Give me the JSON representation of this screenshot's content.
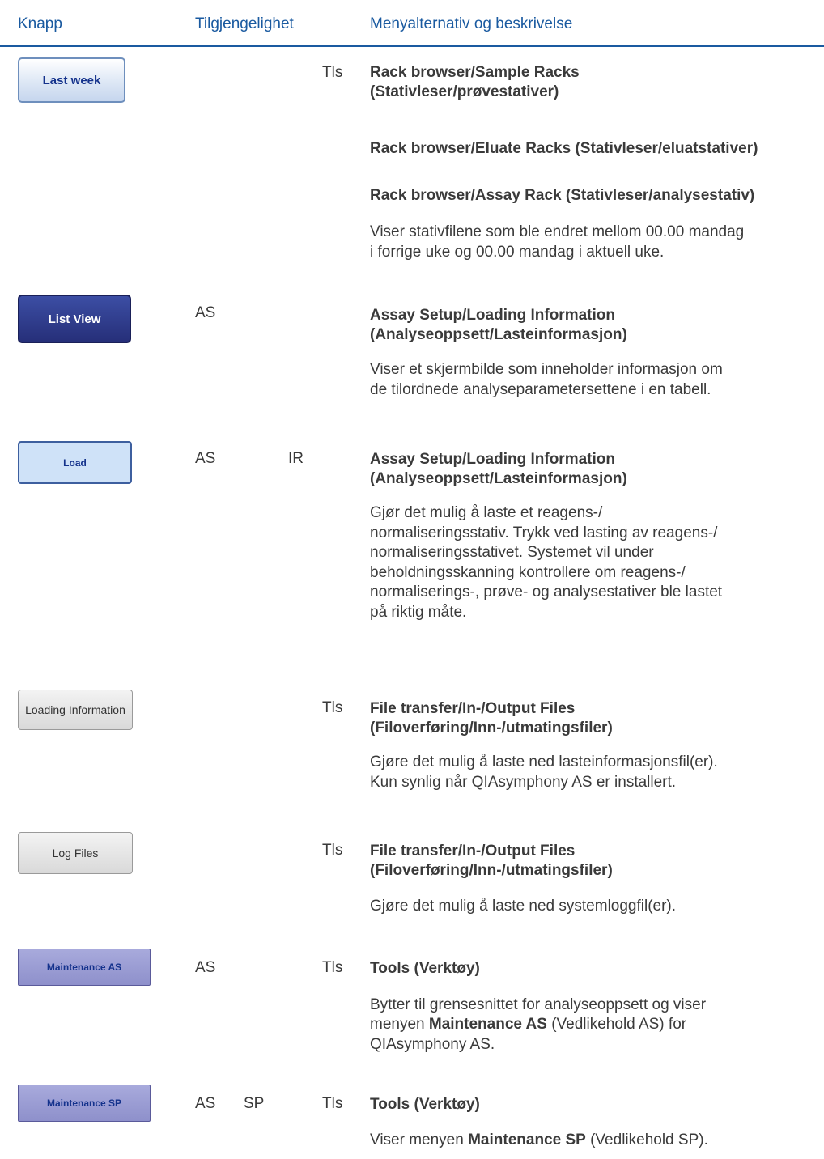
{
  "header": {
    "col_button": "Knapp",
    "col_availability": "Tilgjengelighet",
    "col_menu": "Menyalternativ og beskrivelse"
  },
  "rows": [
    {
      "button": "Last week",
      "tls": "Tls",
      "menus": [
        "Rack browser/Sample Racks",
        "(Stativleser/prøvestativer)",
        "Rack browser/Eluate Racks (Stativleser/eluatstativer)",
        "Rack browser/Assay Rack (Stativleser/analysestativ)"
      ],
      "desc": [
        "Viser stativfilene som ble endret mellom 00.00 mandag",
        "i forrige uke og 00.00 mandag i aktuell uke."
      ]
    },
    {
      "button": "List View",
      "as": "AS",
      "menus": [
        "Assay Setup/Loading Information",
        "(Analyseoppsett/Lasteinformasjon)"
      ],
      "desc": [
        "Viser et skjermbilde som inneholder informasjon om",
        "de tilordnede analyseparametersettene i en tabell."
      ]
    },
    {
      "button": "Load",
      "as": "AS",
      "ir": "IR",
      "menus": [
        "Assay Setup/Loading Information",
        "(Analyseoppsett/Lasteinformasjon)"
      ],
      "desc": [
        "Gjør det mulig å laste et reagens-/",
        "normaliseringsstativ. Trykk ved lasting av reagens-/",
        "normaliseringsstativet. Systemet vil under",
        "beholdningsskanning kontrollere om reagens-/",
        "normaliserings-, prøve- og analysestativer ble lastet",
        "på riktig måte."
      ]
    },
    {
      "button": "Loading Information",
      "tls": "Tls",
      "menus": [
        "File transfer/In-/Output Files",
        "(Filoverføring/Inn-/utmatingsfiler)"
      ],
      "desc": [
        "Gjøre det mulig å laste ned lasteinformasjonsfil(er).",
        "Kun synlig når QIAsymphony AS er installert."
      ]
    },
    {
      "button": "Log Files",
      "tls": "Tls",
      "menus": [
        "File transfer/In-/Output Files",
        "(Filoverføring/Inn-/utmatingsfiler)"
      ],
      "desc": [
        "Gjøre det mulig å laste ned systemloggfil(er)."
      ]
    },
    {
      "button": "Maintenance AS",
      "as": "AS",
      "tls": "Tls",
      "menus": [
        "Tools (Verktøy)"
      ],
      "desc": {
        "l1": "Bytter til grensesnittet for analyseoppsett og viser",
        "l2_pre": "menyen ",
        "l2_bold": "Maintenance AS",
        "l2_post": " (Vedlikehold AS) for",
        "l3": "QIAsymphony AS."
      }
    },
    {
      "button": "Maintenance SP",
      "as": "AS",
      "sp": "SP",
      "tls": "Tls",
      "menus": [
        "Tools (Verktøy)"
      ],
      "desc": {
        "pre": "Viser menyen ",
        "bold": "Maintenance SP",
        "post": " (Vedlikehold SP)."
      }
    }
  ]
}
